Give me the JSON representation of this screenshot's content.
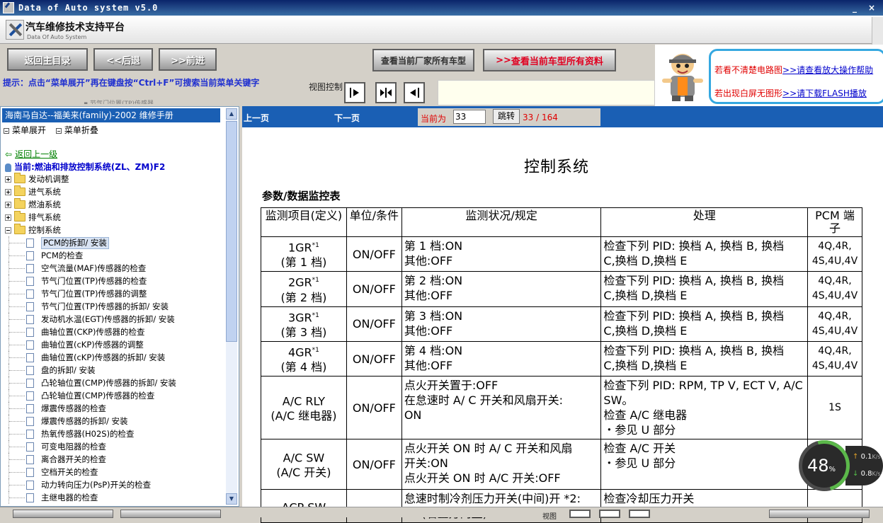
{
  "window": {
    "title": "Data of Auto system v5.0",
    "minimize": "_",
    "close": "×"
  },
  "brand": {
    "title": "汽车维修技术支持平台",
    "subtitle": "Data Of Auto System"
  },
  "toolbar": {
    "back_to_menu": "返回主目录",
    "back": "<<后退",
    "forward": ">>前进",
    "all_models_of_maker": "查看当前厂家所有车型",
    "all_data_of_model": "查看当前车型所有资料"
  },
  "helper": {
    "line1_text": "若看不清楚电路图",
    "line1_link": ">>请查看放大操作帮助",
    "line2_text": "若出现白屏无图形",
    "line2_link": ">>请下载FLASH播放"
  },
  "hint": {
    "text": "提示：点击“菜单展开”再在键盘按“Ctrl+F”可搜索当前菜单关键字",
    "ghost": "▪ 节气门位置(TP)传感器"
  },
  "view_control": {
    "label": "视图控制"
  },
  "left_panel": {
    "header": "海南马自达--福美来(family)-2002 维修手册",
    "expand": "菜单展开",
    "collapse": "菜单折叠",
    "back_up": "返回上一级",
    "current": "当前:燃油和排放控制系统(ZL、ZM)F2",
    "folders": [
      "发动机调整",
      "进气系统",
      "燃油系统",
      "排气系统",
      "控制系统"
    ],
    "items": [
      "PCM的拆卸/ 安装",
      "PCM的检查",
      "空气流量(MAF)传感器的检查",
      "节气门位置(TP)传感器的检查",
      "节气门位置(TP)传感器的调整",
      "节气门位置(TP)传感器的拆卸/ 安装",
      "发动机水温(EGT)传感器的拆卸/ 安装",
      "曲轴位置(CKP)传感器的检查",
      "曲轴位置(cKP)传感器的调整",
      "曲轴位置(cKP)传感器的拆卸/ 安装",
      "盘的拆卸/ 安装",
      "凸轮轴位置(CMP)传感器的拆卸/ 安装",
      "凸轮轴位置(CMP)传感器的检查",
      "爆震传感器的检查",
      "爆震传感器的拆卸/ 安装",
      "热氧传感器(H02S)的检查",
      "可变电阻器的检查",
      "离合器开关的检查",
      "空档开关的检查",
      "动力转向压力(PsP)开关的检查",
      "主继电器的检查"
    ]
  },
  "nav": {
    "prev_page": "上一页",
    "next_page": "下一页",
    "current_label": "当前为",
    "page_value": "33",
    "jump": "跳转",
    "total": "33 / 164"
  },
  "doc": {
    "title": "控制系统",
    "subtitle": "参数/数据监控表",
    "headers": [
      "监测项目(定义)",
      "单位/条件",
      "监测状况/规定",
      "处理",
      "PCM 端子"
    ],
    "rows": [
      {
        "item1": "1GR",
        "sup": "*1",
        "item2": "(第 1 档)",
        "unit": "ON/OFF",
        "cond1": "第 1 档:ON",
        "cond2": "其他:OFF",
        "cond3": "",
        "act1": "检查下列 PID: 换档 A, 换档 B, 换档",
        "act2": "C,换档 D,换档 E",
        "pcm": "4Q,4R,\n4S,4U,4V"
      },
      {
        "item1": "2GR",
        "sup": "*1",
        "item2": "(第 2 档)",
        "unit": "ON/OFF",
        "cond1": "第 2 档:ON",
        "cond2": "其他:OFF",
        "cond3": "",
        "act1": "检查下列 PID: 换档 A, 换档 B, 换档",
        "act2": "C,换档 D,换档 E",
        "pcm": "4Q,4R,\n4S,4U,4V"
      },
      {
        "item1": "3GR",
        "sup": "*1",
        "item2": "(第 3 档)",
        "unit": "ON/OFF",
        "cond1": "第 3 档:ON",
        "cond2": "其他:OFF",
        "cond3": "",
        "act1": "检查下列 PID: 换档 A, 换档 B, 换档",
        "act2": "C,换档 D,换档 E",
        "pcm": "4Q,4R,\n4S,4U,4V"
      },
      {
        "item1": "4GR",
        "sup": "*1",
        "item2": "(第 4 档)",
        "unit": "ON/OFF",
        "cond1": "第 4 档:ON",
        "cond2": "其他:OFF",
        "cond3": "",
        "act1": "检查下列 PID: 换档 A, 换档 B, 换档",
        "act2": "C,换档 D,换档 E",
        "pcm": "4Q,4R,\n4S,4U,4V"
      },
      {
        "item1": "A/C RLY",
        "sup": "",
        "item2": "(A/C 继电器)",
        "unit": "ON/OFF",
        "cond1": "点火开关置于:OFF",
        "cond2": "在怠速时 A/ C 开关和风扇开关:",
        "cond3": "ON",
        "act1": "检查下列 PID: RPM, TP V, ECT V, A/C SW。",
        "act2": "检查 A/C 继电器\n・参见 U 部分",
        "pcm": "1S"
      },
      {
        "item1": "A/C SW",
        "sup": "",
        "item2": "(A/C 开关)",
        "unit": "ON/OFF",
        "cond1": "点火开关 ON 时 A/ C 开关和风扇",
        "cond2": "开关:ON",
        "cond3": "点火开关 ON 时 A/C 开关:OFF",
        "act1": "检查 A/C 开关",
        "act2": "・参见 U 部分",
        "pcm": "1P"
      },
      {
        "item1": "ACP SW",
        "sup": "",
        "item2": "",
        "unit": "",
        "cond1": "怠速时制冷剂压力开关(中间)开 *2:",
        "cond2": "ON(右置方向盘)",
        "cond3": "",
        "act1": "",
        "act2": "检查冷却压力开关",
        "pcm": ""
      }
    ]
  },
  "net_gauge": {
    "percent": "48",
    "percent_unit": "%",
    "up": "0.1",
    "down": "0.8",
    "unit": "K/s"
  },
  "bottom": {
    "view_label": "视图"
  }
}
